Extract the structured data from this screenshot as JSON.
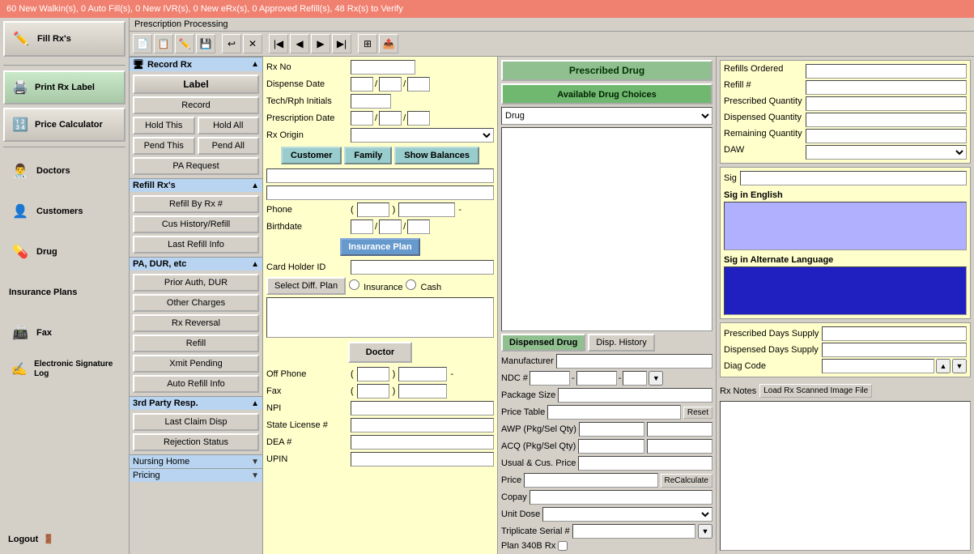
{
  "topbar": {
    "message": "60 New Walkin(s), 0 Auto Fill(s), 0 New IVR(s), 0 New eRx(s), 0 Approved Refill(s), 48 Rx(s) to Verify"
  },
  "sidebar": {
    "fill_rx": "Fill Rx's",
    "print_rx": "Print Rx Label",
    "price_calc": "Price Calculator",
    "doctors": "Doctors",
    "customers": "Customers",
    "drug": "Drug",
    "insurance": "Insurance Plans",
    "fax": "Fax",
    "esig": "Electronic Signature Log",
    "logout": "Logout"
  },
  "prescription_title": "Prescription Processing",
  "left_panel": {
    "record_section": "Record Rx",
    "label_btn": "Label",
    "record_btn": "Record",
    "hold_this": "Hold This",
    "hold_all": "Hold All",
    "pend_this": "Pend This",
    "pend_all": "Pend All",
    "pa_request": "PA Request",
    "refill_section": "Refill Rx's",
    "refill_by_rx": "Refill By Rx #",
    "cus_history": "Cus History/Refill",
    "last_refill": "Last Refill Info",
    "pa_dur_section": "PA, DUR, etc",
    "prior_auth": "Prior Auth, DUR",
    "other_charges": "Other Charges",
    "rx_reversal": "Rx Reversal",
    "refill_btn": "Refill",
    "xmit_pending": "Xmit Pending",
    "auto_refill": "Auto Refill Info",
    "third_party_section": "3rd Party Resp.",
    "last_claim_disp": "Last Claim Disp",
    "rejection_status": "Rejection Status",
    "nursing_home_section": "Nursing Home",
    "pricing_section": "Pricing"
  },
  "middle_form": {
    "rx_no_label": "Rx No",
    "dispense_date_label": "Dispense Date",
    "tech_rph_label": "Tech/Rph Initials",
    "prescription_date_label": "Prescription Date",
    "rx_origin_label": "Rx Origin",
    "customer_btn": "Customer",
    "family_btn": "Family",
    "show_balances_btn": "Show Balances",
    "phone_label": "Phone",
    "birthdate_label": "Birthdate",
    "insurance_plan_btn": "Insurance Plan",
    "card_holder_id_label": "Card Holder ID",
    "select_diff_plan_btn": "Select Diff. Plan",
    "insurance_radio": "Insurance",
    "cash_radio": "Cash",
    "doctor_btn": "Doctor",
    "off_phone_label": "Off Phone",
    "fax_label": "Fax",
    "npi_label": "NPI",
    "state_license_label": "State License #",
    "dea_label": "DEA #",
    "upin_label": "UPIN"
  },
  "drug_panel": {
    "prescribed_drug_btn": "Prescribed Drug",
    "available_drug_choices": "Available Drug Choices",
    "drug_dropdown": "Drug",
    "dispensed_drug_btn": "Dispensed Drug",
    "disp_history_btn": "Disp. History",
    "manufacturer_label": "Manufacturer",
    "ndc_label": "NDC #",
    "package_size_label": "Package Size",
    "price_table_label": "Price Table",
    "reset_btn": "Reset",
    "awp_label": "AWP (Pkg/Sel Qty)",
    "acq_label": "ACQ (Pkg/Sel Qty)",
    "usual_cus_price_label": "Usual & Cus. Price",
    "price_label": "Price",
    "recalculate_btn": "ReCalculate",
    "copay_label": "Copay",
    "unit_dose_label": "Unit Dose",
    "triplicate_label": "Triplicate Serial #",
    "plan_340b_label": "Plan 340B Rx"
  },
  "right_panel": {
    "refills_ordered_label": "Refills Ordered",
    "refill_num_label": "Refill #",
    "prescribed_qty_label": "Prescribed Quantity",
    "dispensed_qty_label": "Dispensed Quantity",
    "remaining_qty_label": "Remaining Quantity",
    "daw_label": "DAW",
    "sig_label": "Sig",
    "sig_in_english_label": "Sig in English",
    "sig_alt_label": "Sig in Alternate Language",
    "prescribed_days_label": "Prescribed Days Supply",
    "dispensed_days_label": "Dispensed Days Supply",
    "diag_code_label": "Diag Code",
    "rx_notes_label": "Rx Notes",
    "load_rx_btn": "Load Rx Scanned Image File"
  },
  "toolbar_buttons": [
    "new",
    "copy",
    "edit",
    "save",
    "undo",
    "delete",
    "first",
    "prev",
    "next",
    "last",
    "grid",
    "extra"
  ]
}
